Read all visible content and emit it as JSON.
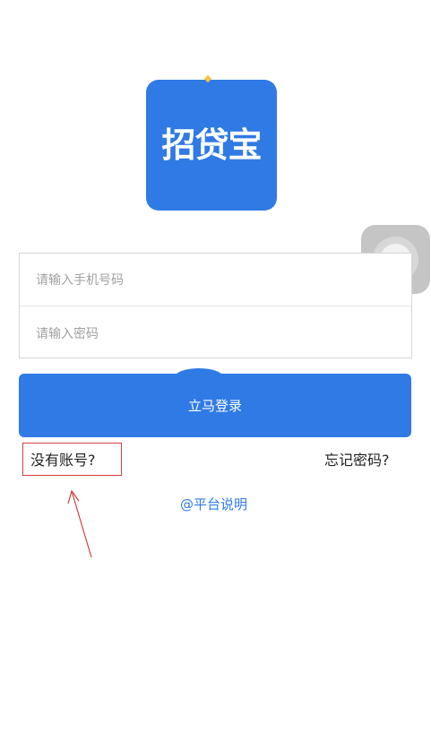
{
  "app": {
    "logo_text": "招贷宝"
  },
  "login_form": {
    "phone_placeholder": "请输入手机号码",
    "password_placeholder": "请输入密码",
    "login_button_label": "立马登录"
  },
  "links": {
    "no_account": "没有账号?",
    "forgot_password": "忘记密码?",
    "platform_info": "@平台说明"
  },
  "colors": {
    "brand_blue": "#2f7ae5",
    "annotation_red": "#d04040"
  },
  "icons": {
    "floating_assistive": "assistive-touch-icon",
    "annotation": "red-arrow-icon"
  }
}
